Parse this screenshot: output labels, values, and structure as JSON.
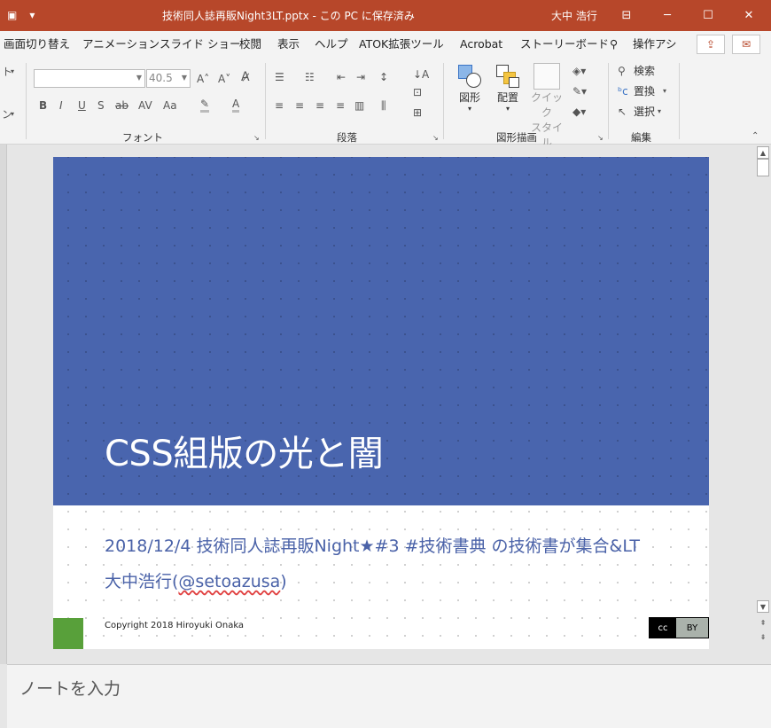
{
  "titlebar": {
    "title": "技術同人誌再販Night3LT.pptx - この PC に保存済み",
    "user": "大中 浩行",
    "minimize": "─",
    "restore": "☐",
    "close": "✕",
    "display_options": "⊟",
    "customize": "▾"
  },
  "tabs": {
    "items": [
      "画面切り替え",
      "アニメーション",
      "スライド ショー",
      "校閲",
      "表示",
      "ヘルプ",
      "ATOK拡張ツール",
      "Acrobat",
      "ストーリーボード"
    ],
    "search": "操作アシ"
  },
  "ribbon": {
    "font_group": "フォント",
    "paragraph_group": "段落",
    "drawing_group": "図形描画",
    "editing_group": "編集",
    "font_name": "",
    "font_size": "40.5",
    "shape_label": "図形",
    "arrange_label": "配置",
    "quick_style_label1": "クイック",
    "quick_style_label2": "スタイル",
    "find_label": "検索",
    "replace_label": "置換",
    "select_label": "選択",
    "left_label1": "ト",
    "left_label2": "ン"
  },
  "slide": {
    "title": "CSS組版の光と闇",
    "subtitle_line1": "2018/12/4 技術同人誌再販Night★#3 #技術書典 の技術書が集合&LT",
    "subtitle_line2_prefix": "大中浩行(",
    "subtitle_handle": "@setoazusa",
    "subtitle_line2_suffix": ")",
    "copyright": "Copyright 2018 Hiroyuki Onaka",
    "cc_left": "cc",
    "cc_right": "BY"
  },
  "notes": {
    "placeholder": "ノートを入力"
  },
  "colors": {
    "titlebar": "#b7472a",
    "slide_blue": "#4965ae",
    "subtitle_text": "#4a62a8",
    "accent_green": "#58a03a"
  }
}
